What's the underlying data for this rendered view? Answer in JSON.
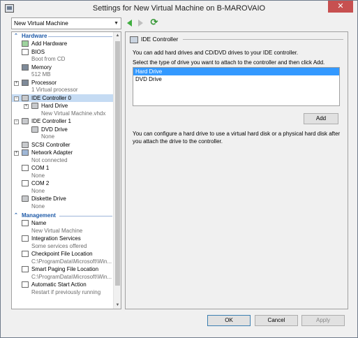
{
  "window": {
    "title": "Settings for New Virtual Machine on B-MAROVAIO",
    "close_label": "✕"
  },
  "vm_selector": {
    "value": "New Virtual Machine"
  },
  "tree": {
    "hardware_header": "Hardware",
    "management_header": "Management",
    "items": [
      {
        "label": "Add Hardware"
      },
      {
        "label": "BIOS",
        "sub": "Boot from CD"
      },
      {
        "label": "Memory",
        "sub": "512 MB"
      },
      {
        "label": "Processor",
        "sub": "1 Virtual processor"
      },
      {
        "label": "IDE Controller 0"
      },
      {
        "label": "Hard Drive",
        "sub": "New Virtual Machine.vhdx"
      },
      {
        "label": "IDE Controller 1"
      },
      {
        "label": "DVD Drive",
        "sub": "None"
      },
      {
        "label": "SCSI Controller"
      },
      {
        "label": "Network Adapter",
        "sub": "Not connected"
      },
      {
        "label": "COM 1",
        "sub": "None"
      },
      {
        "label": "COM 2",
        "sub": "None"
      },
      {
        "label": "Diskette Drive",
        "sub": "None"
      }
    ],
    "mgmt_items": [
      {
        "label": "Name",
        "sub": "New Virtual Machine"
      },
      {
        "label": "Integration Services",
        "sub": "Some services offered"
      },
      {
        "label": "Checkpoint File Location",
        "sub": "C:\\ProgramData\\Microsoft\\Win..."
      },
      {
        "label": "Smart Paging File Location",
        "sub": "C:\\ProgramData\\Microsoft\\Win..."
      },
      {
        "label": "Automatic Start Action",
        "sub": "Restart if previously running"
      }
    ]
  },
  "panel": {
    "title": "IDE Controller",
    "intro": "You can add hard drives and CD/DVD drives to your IDE controller.",
    "instruction": "Select the type of drive you want to attach to the controller and then click Add.",
    "drive_types": [
      "Hard Drive",
      "DVD Drive"
    ],
    "selected_drive": "Hard Drive",
    "add_label": "Add",
    "note": "You can configure a hard drive to use a virtual hard disk or a physical hard disk after you attach the drive to the controller."
  },
  "buttons": {
    "ok": "OK",
    "cancel": "Cancel",
    "apply": "Apply"
  },
  "colors": {
    "selection": "#3399ff",
    "tree_selection": "#c5dbf3",
    "section_header": "#1e5aa8",
    "close_button": "#c75050"
  }
}
